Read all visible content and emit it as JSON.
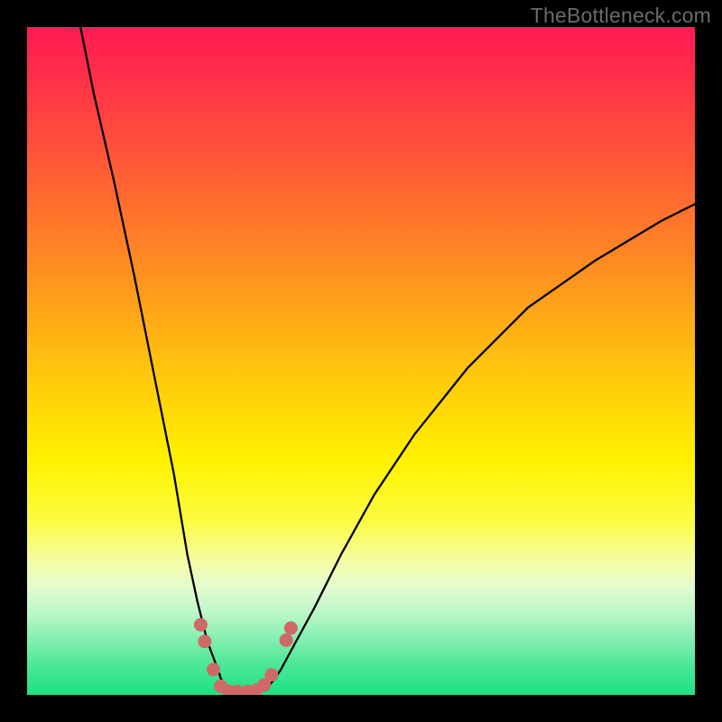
{
  "watermark": "TheBottleneck.com",
  "chart_data": {
    "type": "line",
    "title": "",
    "xlabel": "",
    "ylabel": "",
    "xlim": [
      0,
      100
    ],
    "ylim": [
      0,
      100
    ],
    "series": [
      {
        "name": "bottleneck-curve-left",
        "x": [
          8,
          10,
          13,
          16,
          19,
          22,
          24,
          25.5,
          27,
          28.5,
          29,
          29.5,
          30,
          31
        ],
        "y": [
          100,
          90,
          77,
          63,
          48,
          33,
          21,
          14,
          8,
          4,
          2.5,
          1.5,
          0.8,
          0.5
        ]
      },
      {
        "name": "bottleneck-curve-right",
        "x": [
          35,
          36,
          37,
          38,
          40,
          43,
          47,
          52,
          58,
          66,
          75,
          85,
          95,
          100
        ],
        "y": [
          0.5,
          1.2,
          2.3,
          3.8,
          7.5,
          13,
          21,
          30,
          39,
          49,
          58,
          65,
          71,
          73.5
        ]
      }
    ],
    "markers": [
      {
        "x": 26.0,
        "y": 10.5
      },
      {
        "x": 26.6,
        "y": 8.0
      },
      {
        "x": 27.9,
        "y": 3.8
      },
      {
        "x": 29.0,
        "y": 1.3
      },
      {
        "x": 30.2,
        "y": 0.55
      },
      {
        "x": 31.5,
        "y": 0.5
      },
      {
        "x": 33.0,
        "y": 0.5
      },
      {
        "x": 34.3,
        "y": 0.7
      },
      {
        "x": 35.5,
        "y": 1.5
      },
      {
        "x": 36.6,
        "y": 3.0
      },
      {
        "x": 38.8,
        "y": 8.2
      },
      {
        "x": 39.5,
        "y": 10.0
      }
    ],
    "marker_color": "#cf6967",
    "background_gradient": {
      "top": "#ff1a55",
      "mid": "#fff200",
      "bottom": "#1de183"
    }
  }
}
